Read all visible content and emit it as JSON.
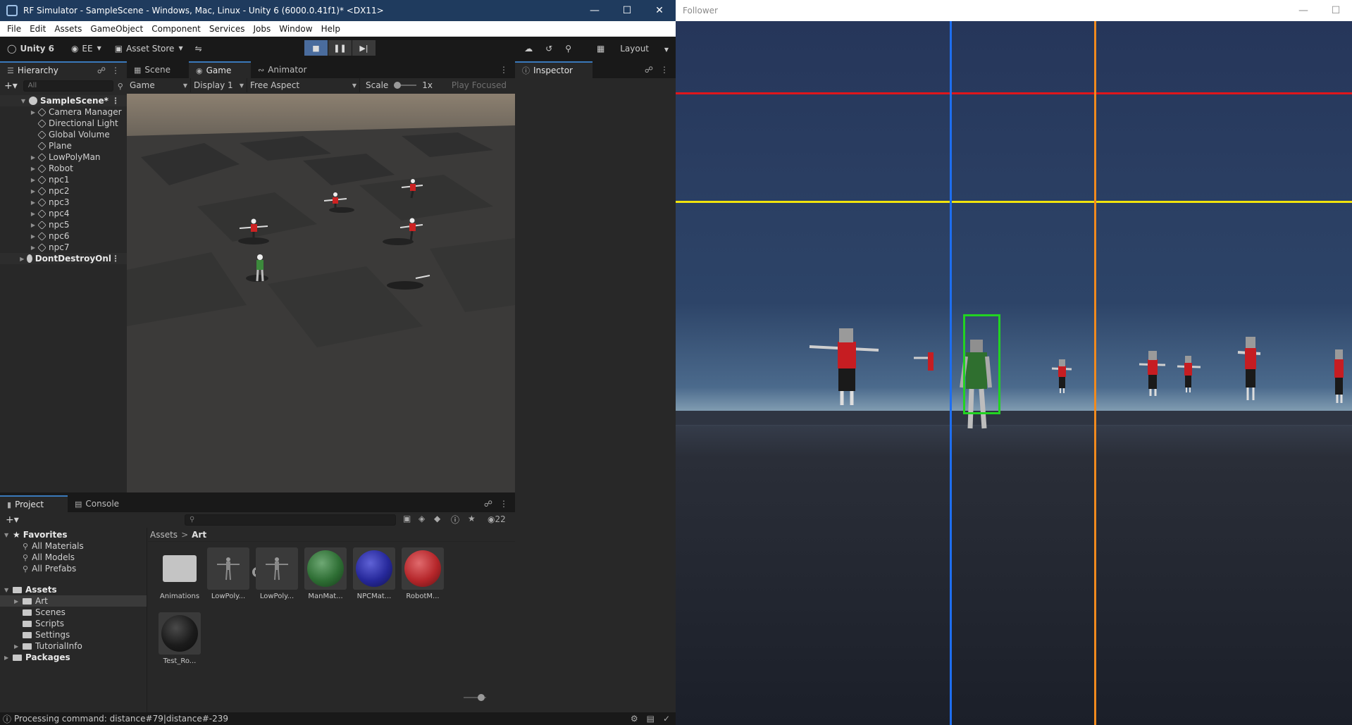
{
  "unity": {
    "window_title": "RF Simulator - SampleScene - Windows, Mac, Linux - Unity 6 (6000.0.41f1)* <DX11>",
    "menu": [
      "File",
      "Edit",
      "Assets",
      "GameObject",
      "Component",
      "Services",
      "Jobs",
      "Window",
      "Help"
    ],
    "toolbar": {
      "unity_label": "Unity 6",
      "account_label": "EE",
      "asset_store_label": "Asset Store",
      "layout_label": "Layout"
    },
    "hierarchy": {
      "tab_label": "Hierarchy",
      "search_placeholder": "All",
      "scene_name": "SampleScene*",
      "items": [
        "Camera Manager",
        "Directional Light",
        "Global Volume",
        "Plane",
        "LowPolyMan",
        "Robot",
        "npc1",
        "npc2",
        "npc3",
        "npc4",
        "npc5",
        "npc6",
        "npc7"
      ],
      "dont_destroy": "DontDestroyOnl"
    },
    "center_tabs": {
      "scene": "Scene",
      "game": "Game",
      "animator": "Animator"
    },
    "game_toolbar": {
      "mode": "Game",
      "display": "Display 1",
      "aspect": "Free Aspect",
      "scale_label": "Scale",
      "scale_value": "1x",
      "play_focused": "Play Focused"
    },
    "inspector": {
      "tab_label": "Inspector"
    },
    "project": {
      "tab_project": "Project",
      "tab_console": "Console",
      "hidden_count": "22",
      "favorites_label": "Favorites",
      "favorites": [
        "All Materials",
        "All Models",
        "All Prefabs"
      ],
      "assets_label": "Assets",
      "asset_folders": [
        "Art",
        "Scenes",
        "Scripts",
        "Settings",
        "TutorialInfo"
      ],
      "packages_label": "Packages",
      "breadcrumb": {
        "root": "Assets",
        "current": "Art"
      },
      "assets": [
        {
          "name": "Animations",
          "kind": "folder"
        },
        {
          "name": "LowPoly...",
          "kind": "model"
        },
        {
          "name": "LowPoly...",
          "kind": "model"
        },
        {
          "name": "ManMat...",
          "kind": "material",
          "color": "#2e6e34"
        },
        {
          "name": "NPCMat...",
          "kind": "material",
          "color": "#26289a"
        },
        {
          "name": "RobotM...",
          "kind": "material",
          "color": "#b5262a"
        },
        {
          "name": "Test_Ro...",
          "kind": "material",
          "color": "#1b1b1b"
        }
      ]
    },
    "status_text": "Processing command: distance#79|distance#-239"
  },
  "follower": {
    "window_title": "Follower",
    "colors": {
      "red": "#e0161b",
      "yellow": "#f2e30c",
      "blue": "#1e6ef0",
      "orange": "#f08a1e",
      "bbox": "#22d322"
    }
  }
}
